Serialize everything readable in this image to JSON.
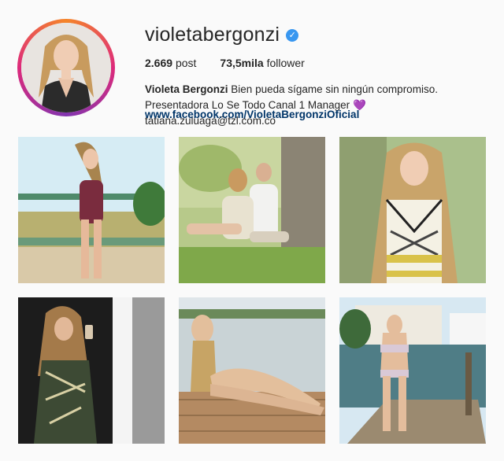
{
  "profile": {
    "username": "violetabergonzi",
    "verified": true,
    "stats": {
      "posts_value": "2.669",
      "posts_label": "post",
      "followers_value": "73,5mila",
      "followers_label": "follower"
    },
    "bio": {
      "name": "Violeta Bergonzi",
      "text": "Bien pueda sígame sin ningún compromiso. Presentadora Lo Se Todo Canal 1 Manager",
      "email": "tatiana.zuluaga@tzl.com.co"
    },
    "link": "www.facebook.com/VioletaBergonziOficial"
  },
  "colors": {
    "verified": "#3897f0",
    "link": "#003569",
    "heart": "#9b51e0"
  },
  "posts": [
    {
      "icon": "photo-burgundy-swimsuit-beach"
    },
    {
      "icon": "photo-couple-sitting-tree"
    },
    {
      "icon": "photo-patterned-swimsuit"
    },
    {
      "icon": "photo-mirror-selfie-dress"
    },
    {
      "icon": "photo-gold-swimsuit-dock"
    },
    {
      "icon": "photo-floral-bikini-pier"
    }
  ]
}
